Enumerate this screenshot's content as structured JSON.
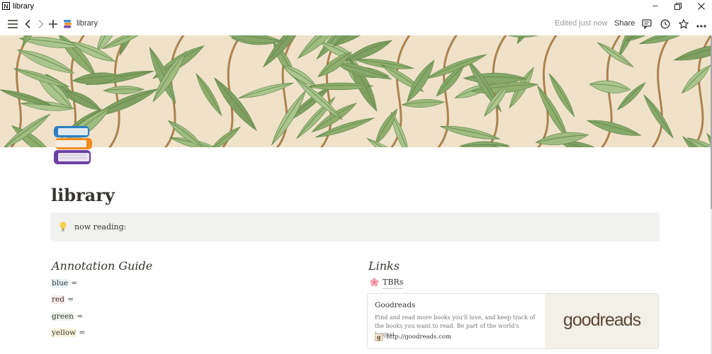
{
  "window": {
    "title": "library",
    "app_logo": "N",
    "controls": [
      "minimize-icon",
      "restore-icon",
      "close-icon"
    ]
  },
  "topbar": {
    "breadcrumb": "library",
    "edited": "Edited just now",
    "share": "Share",
    "icons": [
      "menu-icon",
      "back-icon",
      "forward-icon",
      "add-icon",
      "comments-icon",
      "history-icon",
      "star-icon",
      "more-icon"
    ]
  },
  "page": {
    "title": "library",
    "callout": {
      "icon": "lightbulb-icon",
      "text": "now reading:"
    },
    "annotation_guide": {
      "heading": "Annotation Guide",
      "items": [
        {
          "color_word": "blue",
          "suffix": " =",
          "highlight": "#e7f3f8"
        },
        {
          "color_word": "red",
          "suffix": " =",
          "highlight": "#fdebec"
        },
        {
          "color_word": "green",
          "suffix": " =",
          "highlight": "#edf3ec"
        },
        {
          "color_word": "yellow",
          "suffix": " =",
          "highlight": "#fbf3db"
        }
      ]
    },
    "links": {
      "heading": "Links",
      "tbr": {
        "icon": "cherry-blossom-icon",
        "label": "TBRs"
      },
      "bookmark": {
        "title": "Goodreads",
        "description": "Find and read more books you'll love, and keep track of the books you want to read. Be part of the world's largest",
        "url": "http://goodreads.com",
        "favicon_letter": "g",
        "thumbnail_text": "goodreads"
      }
    }
  },
  "colors": {
    "text": "#37352f",
    "muted": "#9b9a97",
    "callout_bg": "#f1f1ef",
    "cover_bg": "#efe2c9",
    "leaf_green": "#8fae6e",
    "stem_brown": "#a0713a"
  }
}
